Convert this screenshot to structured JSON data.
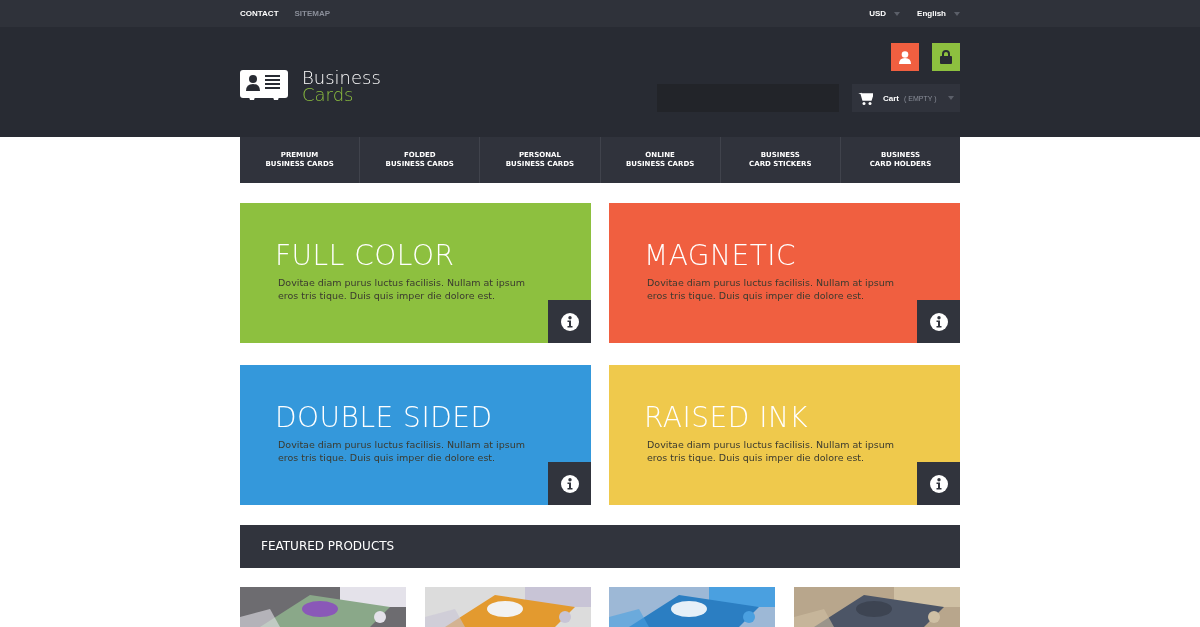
{
  "top_bar": {
    "links": [
      {
        "label": "CONTACT",
        "active": true
      },
      {
        "label": "SITEMAP",
        "active": false
      }
    ],
    "currency": "USD",
    "language": "English"
  },
  "header": {
    "logo": {
      "line_1": "Business",
      "line_2": "Cards"
    },
    "cart": {
      "label": "Cart",
      "status": "( EMPTY )"
    }
  },
  "nav": [
    {
      "lines": [
        "PREMIUM",
        "BUSINESS CARDS"
      ]
    },
    {
      "lines": [
        "FOLDED",
        "BUSINESS CARDS"
      ]
    },
    {
      "lines": [
        "PERSONAL",
        "BUSINESS CARDS"
      ]
    },
    {
      "lines": [
        "ONLINE",
        "BUSINESS CARDS"
      ]
    },
    {
      "lines": [
        "BUSINESS",
        "CARD STICKERS"
      ]
    },
    {
      "lines": [
        "BUSINESS",
        "CARD HOLDERS"
      ]
    }
  ],
  "banners": [
    {
      "title": "FULL COLOR",
      "text": "Dovitae diam purus luctus facilisis. Nullam at ipsum eros tris tique. Duis quis imper die dolore est.",
      "color": "#8dc03f"
    },
    {
      "title": "MAGNETIC",
      "text": "Dovitae diam purus luctus facilisis. Nullam at ipsum eros tris tique. Duis quis imper die dolore est.",
      "color": "#f05f40"
    },
    {
      "title": "DOUBLE SIDED",
      "text": "Dovitae diam purus luctus facilisis. Nullam at ipsum eros tris tique. Duis quis imper die dolore est.",
      "color": "#3498db"
    },
    {
      "title": "RAISED INK",
      "text": "Dovitae diam purus luctus facilisis. Nullam at ipsum eros tris tique. Duis quis imper die dolore est.",
      "color": "#efc94c"
    }
  ],
  "featured": {
    "title": "FEATURED PRODUCTS"
  }
}
